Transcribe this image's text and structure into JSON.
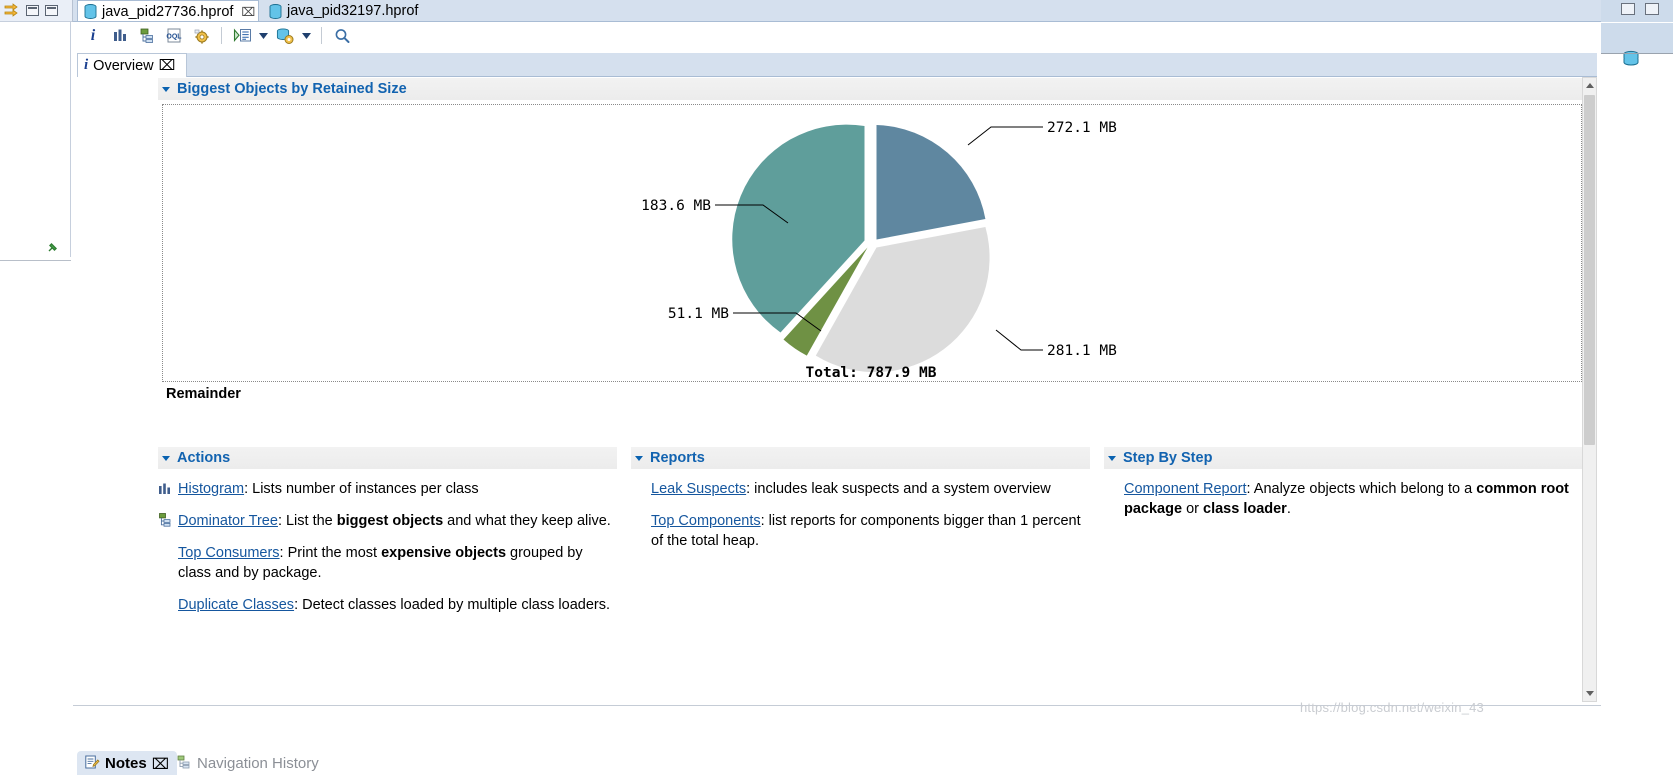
{
  "window": {
    "left_strip": {
      "restore_icon": "restore-view-icon",
      "minimize_button": "minimize-button",
      "maximize_button": "maximize-button",
      "pin_icon": "pin-icon"
    },
    "right_strip": {
      "minimize_button": "minimize-button",
      "maximize_button": "maximize-button",
      "heap_icon": "heap-dump-icon"
    }
  },
  "editor_tabs": [
    {
      "label": "java_pid27736.hprof",
      "icon": "heap-dump-icon",
      "active": true,
      "close": "⌧"
    },
    {
      "label": "java_pid32197.hprof",
      "icon": "heap-dump-icon",
      "active": false,
      "close": ""
    }
  ],
  "toolbar": {
    "items": [
      {
        "name": "overview-info-icon",
        "glyph": "i",
        "tooltip": "Overview"
      },
      {
        "name": "histogram-icon",
        "glyph": "bars",
        "tooltip": "Histogram"
      },
      {
        "name": "dominator-tree-icon",
        "glyph": "tree",
        "tooltip": "Dominator Tree"
      },
      {
        "name": "oql-icon",
        "glyph": "oql",
        "tooltip": "OQL Studio"
      },
      {
        "name": "inspections-icon",
        "glyph": "gear",
        "tooltip": "Run Expert System Test"
      },
      {
        "name": "run-query-icon",
        "glyph": "run",
        "tooltip": "Open Query Browser"
      },
      {
        "name": "run-query-arrow",
        "glyph": "caret",
        "tooltip": "Open Query Browser menu"
      },
      {
        "name": "heap-actions-icon",
        "glyph": "heapgear",
        "tooltip": "Heap Dump actions"
      },
      {
        "name": "heap-actions-arrow",
        "glyph": "caret",
        "tooltip": "Heap Dump actions menu"
      },
      {
        "name": "search-icon",
        "glyph": "search",
        "tooltip": "Find"
      }
    ]
  },
  "view_tab": {
    "label": "Overview",
    "icon": "overview-info-icon",
    "close": "⌧"
  },
  "sections": {
    "biggest_objects": {
      "title": "Biggest Objects by Retained Size",
      "remainder_label": "Remainder"
    },
    "actions": {
      "title": "Actions"
    },
    "reports": {
      "title": "Reports"
    },
    "step_by_step": {
      "title": "Step By Step"
    }
  },
  "actions_entries": [
    {
      "icon": "histogram-icon",
      "link": "Histogram",
      "parts": [
        {
          "text": ": Lists number of instances per class",
          "bold": false
        }
      ]
    },
    {
      "icon": "dominator-tree-icon",
      "link": "Dominator Tree",
      "parts": [
        {
          "text": ": List the ",
          "bold": false
        },
        {
          "text": "biggest objects",
          "bold": true
        },
        {
          "text": " and what they keep alive.",
          "bold": false
        }
      ]
    },
    {
      "icon": "",
      "link": "Top Consumers",
      "parts": [
        {
          "text": ": Print the most ",
          "bold": false
        },
        {
          "text": "expensive objects",
          "bold": true
        },
        {
          "text": " grouped by class and by package.",
          "bold": false
        }
      ]
    },
    {
      "icon": "",
      "link": "Duplicate Classes",
      "parts": [
        {
          "text": ": Detect classes loaded by multiple class loaders.",
          "bold": false
        }
      ]
    }
  ],
  "reports_entries": [
    {
      "icon": "",
      "link": "Leak Suspects",
      "parts": [
        {
          "text": ": includes leak suspects and a system overview",
          "bold": false
        }
      ]
    },
    {
      "icon": "",
      "link": "Top Components",
      "parts": [
        {
          "text": ": list reports for components bigger than 1 percent of the total heap.",
          "bold": false
        }
      ]
    }
  ],
  "step_entries": [
    {
      "icon": "",
      "link": "Component Report",
      "parts": [
        {
          "text": ": Analyze objects which belong to a ",
          "bold": false
        },
        {
          "text": "common root package",
          "bold": true
        },
        {
          "text": " or ",
          "bold": false
        },
        {
          "text": "class loader",
          "bold": true
        },
        {
          "text": ".",
          "bold": false
        }
      ]
    }
  ],
  "bottom_tabs": [
    {
      "label": "Notes",
      "icon": "notes-icon",
      "active": true,
      "close": "⌧"
    },
    {
      "label": "Navigation History",
      "icon": "navigation-history-icon",
      "active": false,
      "close": ""
    }
  ],
  "watermark": "https://blog.csdn.net/weixin_43",
  "colors": {
    "slice_1": "#5f87a0",
    "slice_2": "#5f9e9b",
    "slice_3": "#6f9144",
    "slice_4": "#dcdcdc",
    "link": "#15569e",
    "section_title": "#1263b0",
    "tab_bar": "#d5e0ee"
  },
  "chart_data": {
    "type": "pie",
    "title": "Biggest Objects by Retained Size",
    "unit": "MB",
    "total_label": "Total: 787.9 MB",
    "total": 787.9,
    "labels": [
      "272.1 MB",
      "183.6 MB",
      "51.1 MB",
      "281.1 MB"
    ],
    "values": [
      272.1,
      183.6,
      51.1,
      281.1
    ],
    "colors": [
      "#5f87a0",
      "#5f9e9b",
      "#6f9144",
      "#dcdcdc"
    ],
    "legend": "none",
    "grid": false,
    "exploded": true,
    "remainder_label": "Remainder"
  }
}
